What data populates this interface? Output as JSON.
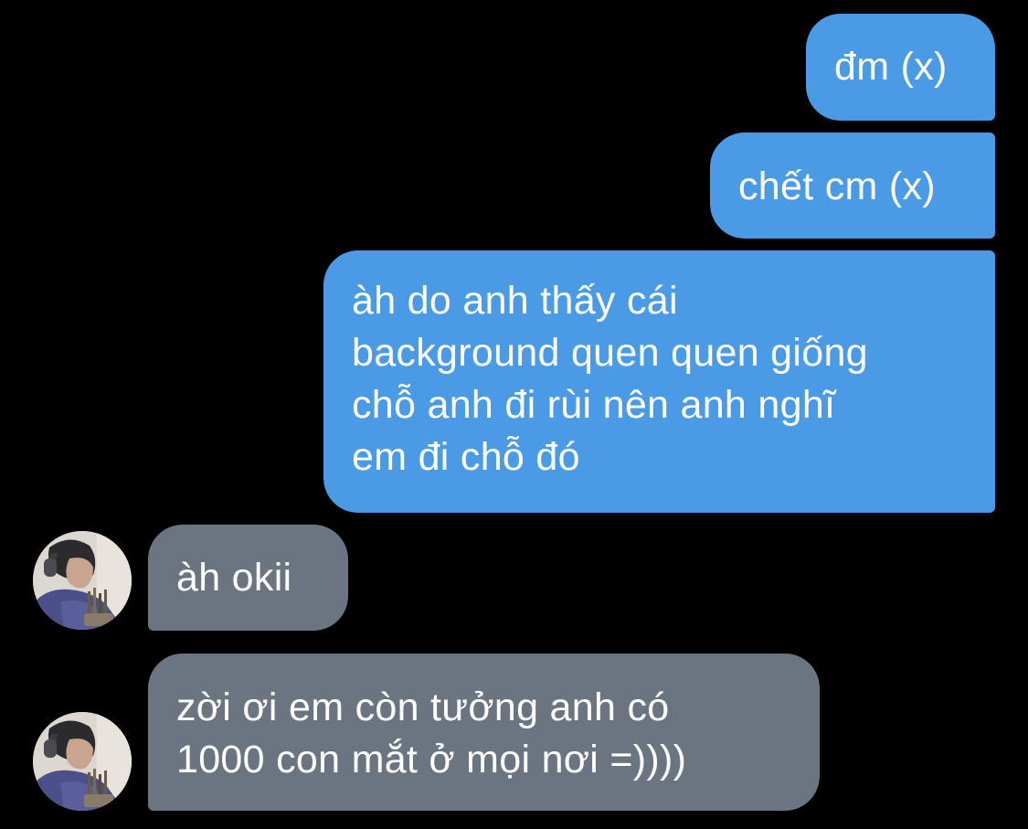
{
  "colors": {
    "background": "#000000",
    "sent_bubble": "#4a9ae6",
    "received_bubble": "#6b7582",
    "text": "#ffffff"
  },
  "messages": [
    {
      "direction": "sent",
      "lines": [
        "đm (x)"
      ]
    },
    {
      "direction": "sent",
      "lines": [
        "chết cm (x)"
      ]
    },
    {
      "direction": "sent",
      "lines": [
        "àh do anh thấy cái",
        "background quen quen giống",
        "chỗ anh đi rùi nên anh nghĩ",
        "em đi chỗ đó"
      ]
    },
    {
      "direction": "received",
      "lines": [
        "àh okii"
      ]
    },
    {
      "direction": "received",
      "lines": [
        "zời ơi em còn tưởng anh có",
        "1000 con mắt ở mọi nơi =))))"
      ]
    }
  ]
}
